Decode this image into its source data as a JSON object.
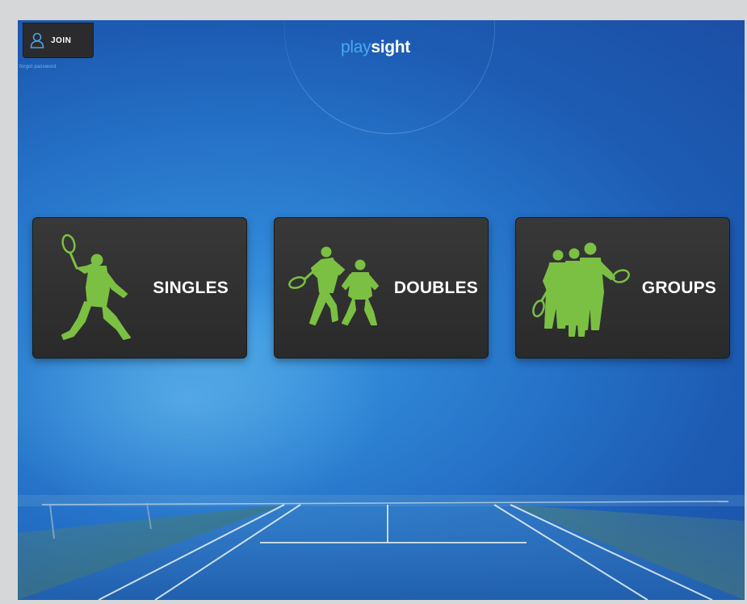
{
  "header": {
    "join_label": "JOIN",
    "forgot_label": "forgot password",
    "logo_part1": "play",
    "logo_part2": "sight"
  },
  "modes": [
    {
      "label": "SINGLES",
      "icon": "singles-player-icon"
    },
    {
      "label": "DOUBLES",
      "icon": "doubles-players-icon"
    },
    {
      "label": "GROUPS",
      "icon": "group-players-icon"
    }
  ],
  "colors": {
    "background": "#2572c8",
    "card": "#2f2f2f",
    "silhouette": "#7bc043",
    "logo_accent": "#46a9ef"
  }
}
